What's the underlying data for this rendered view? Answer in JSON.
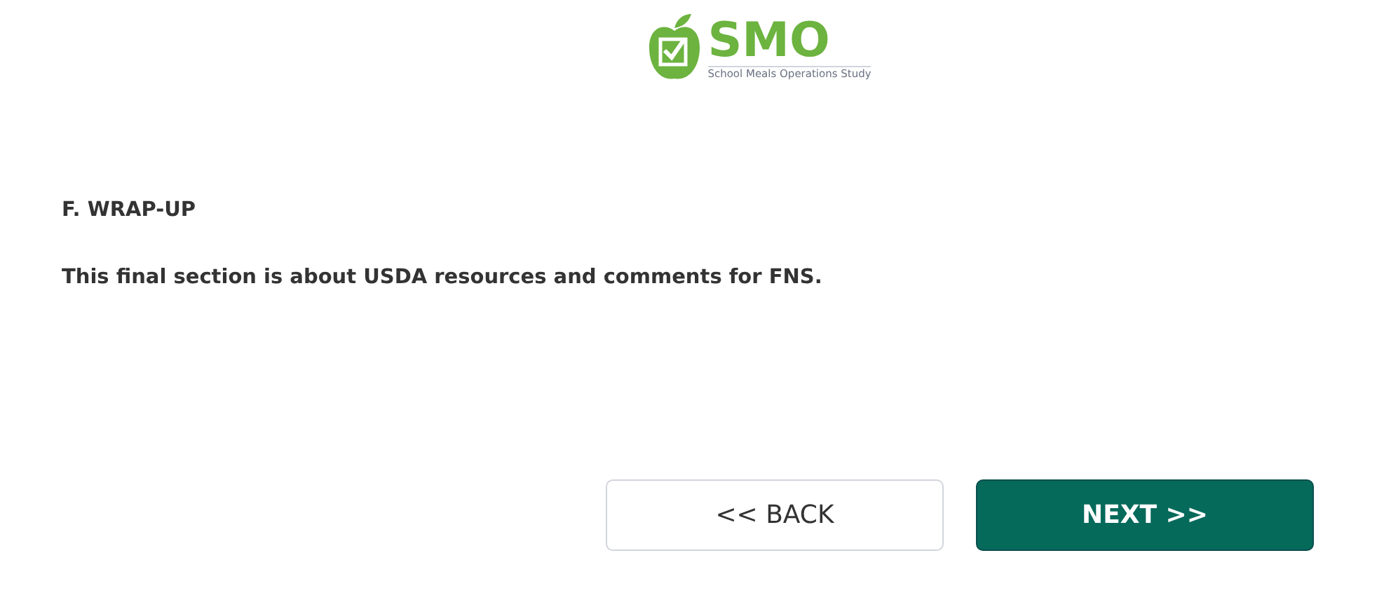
{
  "logo": {
    "title": "SMO",
    "subtitle": "School Meals Operations Study"
  },
  "section": {
    "heading": "F. WRAP-UP",
    "description": "This final section is about USDA resources and comments for FNS."
  },
  "buttons": [
    {
      "label": "<< BACK",
      "kind": "secondary"
    },
    {
      "label": "NEXT >>",
      "kind": "primary"
    }
  ]
}
